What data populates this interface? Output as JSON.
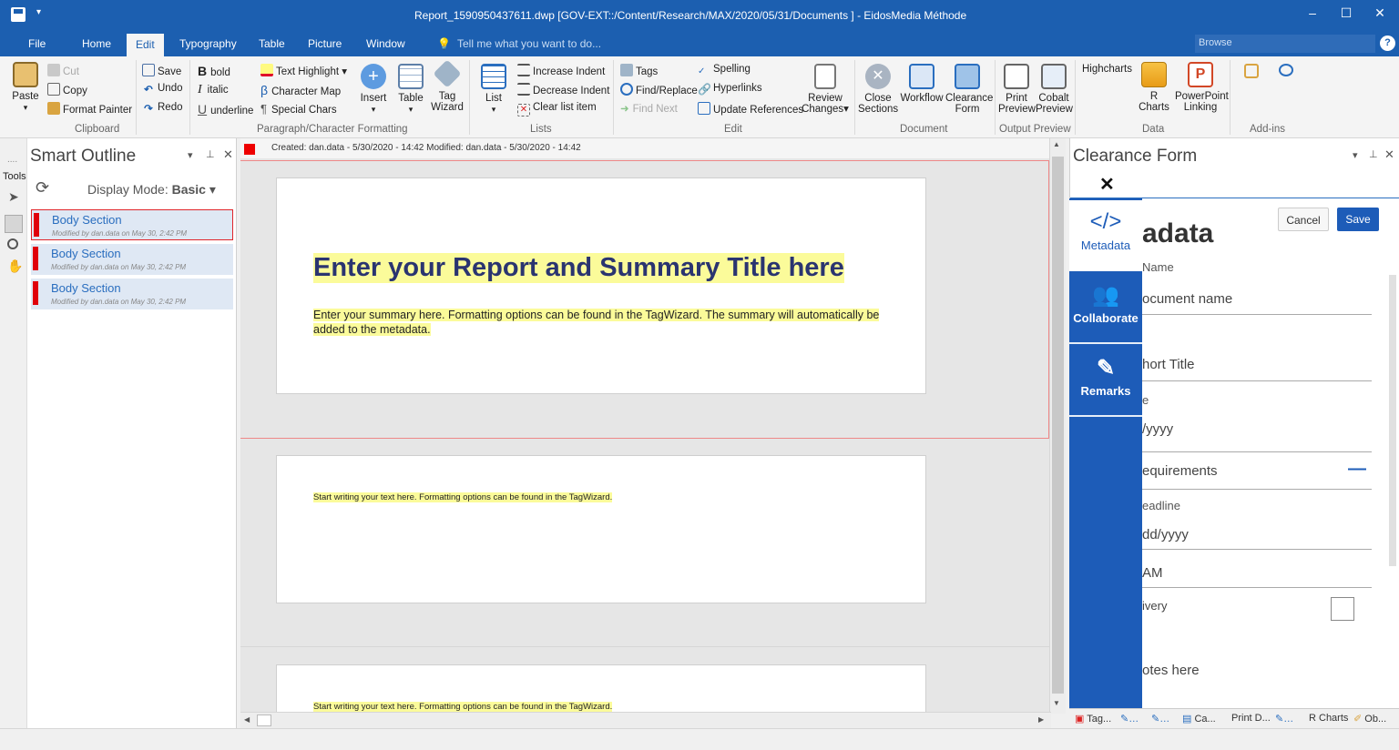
{
  "window": {
    "title": "Report_1590950437611.dwp  [GOV-EXT::/Content/Research/MAX/2020/05/31/Documents ] - EidosMedia Méthode",
    "minimize": "–",
    "maximize": "☐",
    "close": "✕"
  },
  "menu": {
    "tabs": [
      "File",
      "Home",
      "Edit",
      "Typography",
      "Table",
      "Picture",
      "Window"
    ],
    "tell_me": "Tell me what you want to do...",
    "browse": "Browse"
  },
  "ribbon": {
    "clipboard": {
      "paste": "Paste",
      "cut": "Cut",
      "copy": "Copy",
      "format_painter": "Format Painter",
      "label": "Clipboard"
    },
    "undo": {
      "save": "Save",
      "undo": "Undo",
      "redo": "Redo"
    },
    "formatting": {
      "bold": "bold",
      "italic": "italic",
      "underline": "underline",
      "text_highlight": "Text Highlight",
      "character_map": "Character Map",
      "special_chars": "Special Chars",
      "insert": "Insert",
      "table": "Table",
      "tag_wizard_1": "Tag",
      "tag_wizard_2": "Wizard",
      "label": "Paragraph/Character Formatting"
    },
    "lists": {
      "list": "List",
      "increase_indent": "Increase Indent",
      "decrease_indent": "Decrease Indent",
      "clear_list_item": "Clear list item",
      "label": "Lists"
    },
    "edit": {
      "tags": "Tags",
      "find_replace": "Find/Replace",
      "find_next": "Find Next",
      "spelling": "Spelling",
      "hyperlinks": "Hyperlinks",
      "update_references": "Update References",
      "review_1": "Review",
      "review_2": "Changes",
      "label": "Edit"
    },
    "document": {
      "close_1": "Close",
      "close_2": "Sections",
      "workflow": "Workflow",
      "clearance_1": "Clearance",
      "clearance_2": "Form",
      "label": "Document"
    },
    "output": {
      "print_1": "Print",
      "print_2": "Preview",
      "cobalt_1": "Cobalt",
      "cobalt_2": "Preview",
      "label": "Output Preview"
    },
    "data": {
      "highcharts": "Highcharts",
      "r_1": "R",
      "r_2": "Charts",
      "pp_1": "PowerPoint",
      "pp_2": "Linking",
      "label": "Data"
    },
    "addins": {
      "label": "Add-ins"
    }
  },
  "tools": {
    "label": "Tools"
  },
  "outline": {
    "title": "Smart Outline",
    "display_mode_label": "Display Mode:",
    "display_mode_value": "Basic",
    "sections": [
      {
        "name": "Body Section",
        "meta": "Modified by dan.data on May 30, 2:42 PM"
      },
      {
        "name": "Body Section",
        "meta": "Modified by dan.data on May 30, 2:42 PM"
      },
      {
        "name": "Body Section",
        "meta": "Modified by dan.data on May 30, 2:42 PM"
      }
    ]
  },
  "editor": {
    "info": "Created: dan.data - 5/30/2020 - 14:42   Modified: dan.data - 5/30/2020 - 14:42",
    "title": "Enter your Report and Summary Title here",
    "summary": "Enter your summary here. Formatting options can be found in the TagWizard. The summary will automatically be added to the metadata.",
    "body1": "Start writing your text here. Formatting options can be found in the TagWizard.",
    "body2": "Start writing your text here. Formatting options can be found in the TagWizard."
  },
  "clearance": {
    "title": "Clearance Form",
    "close": "✕",
    "cancel": "Cancel",
    "save": "Save",
    "nav": [
      "Metadata",
      "Collaborate",
      "Remarks"
    ],
    "heading": "adata",
    "fields": {
      "name_label": "Name",
      "name_value": "ocument name",
      "short_title": "hort Title",
      "e": "e",
      "date1": "/yyyy",
      "requirements": "equirements",
      "minus": "—",
      "deadline": "eadline",
      "date2": "dd/yyyy",
      "am": "AM",
      "ivery": "ivery",
      "notes": "otes here"
    }
  },
  "bottom_tabs": [
    "Tag...",
    "Ca...",
    "Print D...",
    "R Charts",
    "Ob..."
  ]
}
